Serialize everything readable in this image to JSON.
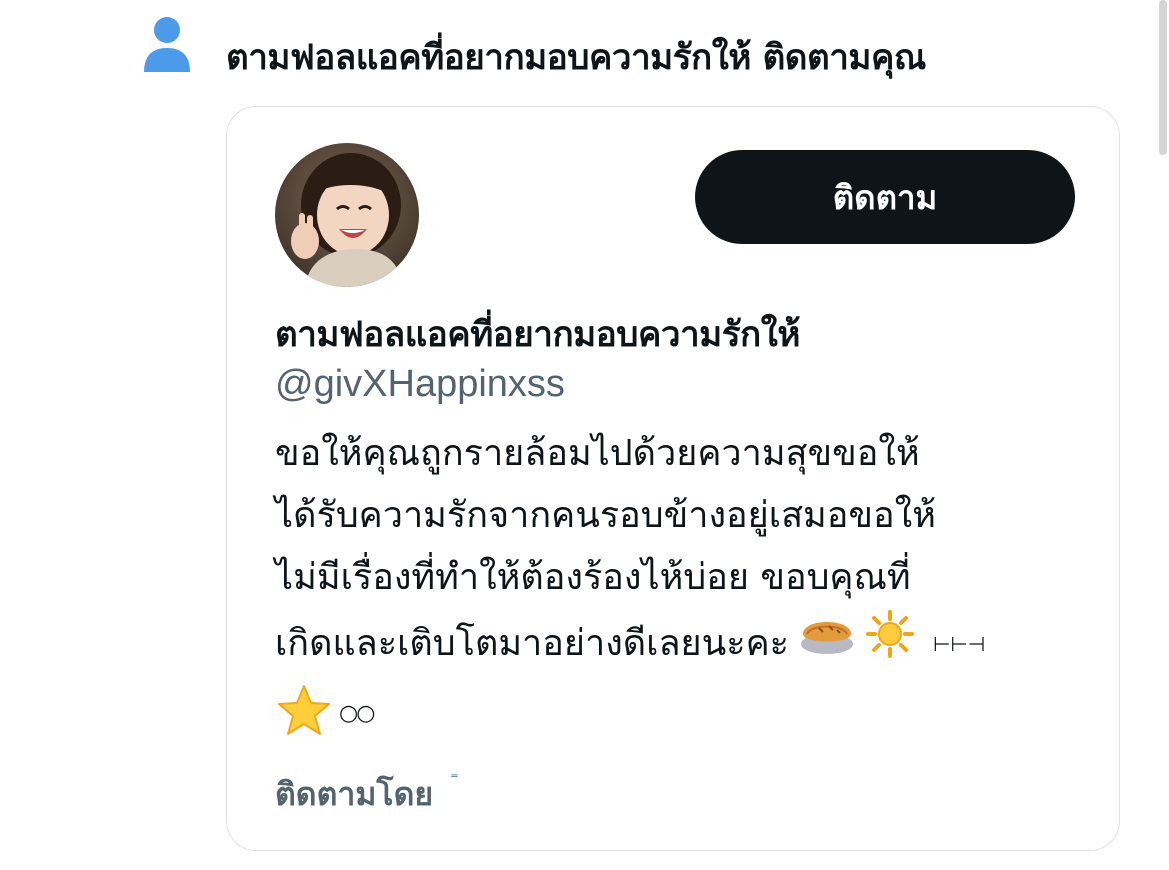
{
  "notification": {
    "text": "ตามฟอลแอคที่อยากมอบความรักให้ ติดตามคุณ",
    "icon": "person-icon",
    "icon_color": "#4c9be8"
  },
  "card": {
    "follow_button_label": "ติดตาม",
    "display_name": "ตามฟอลแอคที่อยากมอบความรักให้",
    "handle": "@givXHappinxss",
    "bio_lines": [
      "ขอให้คุณถูกรายล้อมไปด้วยความสุขขอให้",
      "ได้รับความรักจากคนรอบข้างอยู่เสมอขอให้",
      "ไม่มีเรื่องที่ทำให้ต้องร้องไห้บ่อย ขอบคุณที่",
      "เกิดและเติบโตมาอย่างดีเลยนะคะ"
    ],
    "bio_symbols": "⊢⊢⊣",
    "bio_trailing_rings": "○○",
    "emojis": [
      "pie-emoji",
      "sun-emoji",
      "star-emoji"
    ],
    "followed_by_label": "ติดตามโดย",
    "followed_by_mark": "⁼"
  },
  "colors": {
    "button_bg": "#0f1419",
    "text_primary": "#0f1419",
    "text_secondary": "#536471",
    "card_border": "#dfe3e6"
  }
}
